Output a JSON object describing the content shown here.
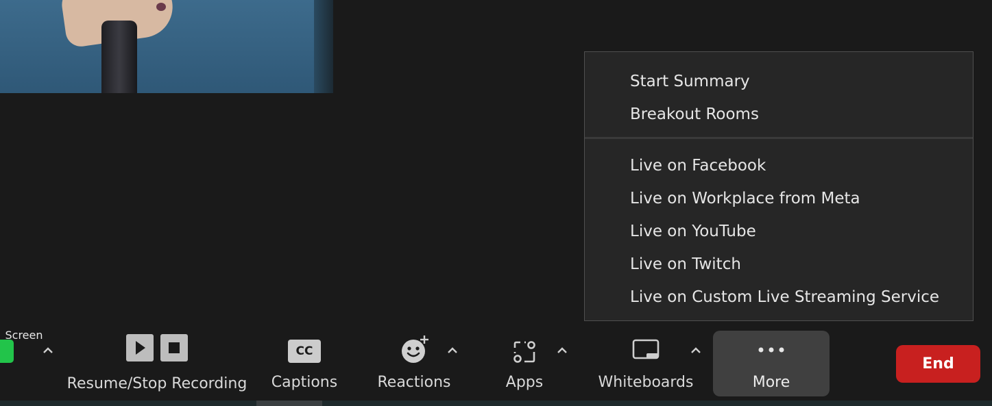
{
  "more_menu": {
    "section1": [
      {
        "label": "Start Summary"
      },
      {
        "label": "Breakout Rooms"
      }
    ],
    "section2": [
      {
        "label": "Live on Facebook"
      },
      {
        "label": "Live on Workplace from Meta"
      },
      {
        "label": "Live on YouTube"
      },
      {
        "label": "Live on Twitch"
      },
      {
        "label": "Live on Custom Live Streaming Service"
      }
    ]
  },
  "toolbar": {
    "share_label_partial": "Screen",
    "recording_label": "Resume/Stop Recording",
    "captions_label": "Captions",
    "captions_icon_text": "CC",
    "reactions_label": "Reactions",
    "apps_label": "Apps",
    "whiteboards_label": "Whiteboards",
    "more_label": "More",
    "end_label": "End"
  },
  "colors": {
    "background": "#1a1a1a",
    "menu_background": "#262626",
    "share_green": "#26c94b",
    "end_red": "#c8201f",
    "more_active": "#404040"
  },
  "icons": {
    "reactions": "smiley-plus-icon",
    "apps": "apps-icon",
    "whiteboards": "whiteboard-icon",
    "more": "ellipsis-icon",
    "resume": "play-icon",
    "stop": "stop-icon",
    "caret": "caret-up-icon"
  }
}
